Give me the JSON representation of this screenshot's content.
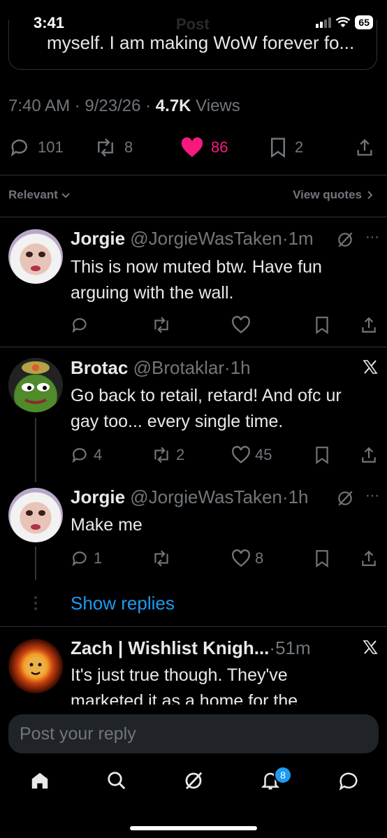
{
  "status_bar": {
    "time": "3:41",
    "ghost_title": "Post",
    "battery": "65"
  },
  "quote_preview": {
    "text": "myself. I am making WoW forever fo..."
  },
  "post_meta": {
    "time": "7:40 AM",
    "date": "9/23/26",
    "views_count": "4.7K",
    "views_label": "Views"
  },
  "post_stats": {
    "replies": "101",
    "reposts": "8",
    "likes": "86",
    "bookmarks": "2"
  },
  "filters": {
    "sort_label": "Relevant",
    "quotes_label": "View quotes"
  },
  "replies": [
    {
      "name": "Jorgie",
      "handle": "@JorgieWasTaken",
      "time": "1m",
      "text": "This is now muted btw. Have fun arguing with the wall.",
      "replies": "",
      "reposts": "",
      "likes": ""
    },
    {
      "name": "Brotac",
      "handle": "@Brotaklar",
      "time": "1h",
      "text": "Go back to retail, retard! And ofc ur gay too... every single time.",
      "replies": "4",
      "reposts": "2",
      "likes": "45"
    },
    {
      "name": "Jorgie",
      "handle": "@JorgieWasTaken",
      "time": "1h",
      "text": "Make me",
      "replies": "1",
      "reposts": "",
      "likes": "8"
    },
    {
      "name": "Zach | Wishlist Knigh...",
      "handle": "",
      "time": "51m",
      "text": "It's just true though. They've marketed it as a home for the",
      "replies": "",
      "reposts": "",
      "likes": ""
    }
  ],
  "show_replies_label": "Show replies",
  "reply_input": {
    "placeholder": "Post your reply"
  },
  "tab_bar": {
    "notifications_badge": "8"
  },
  "colors": {
    "accent": "#1d9bf0",
    "like": "#f91880",
    "background": "#000000",
    "muted": "#71767b"
  }
}
